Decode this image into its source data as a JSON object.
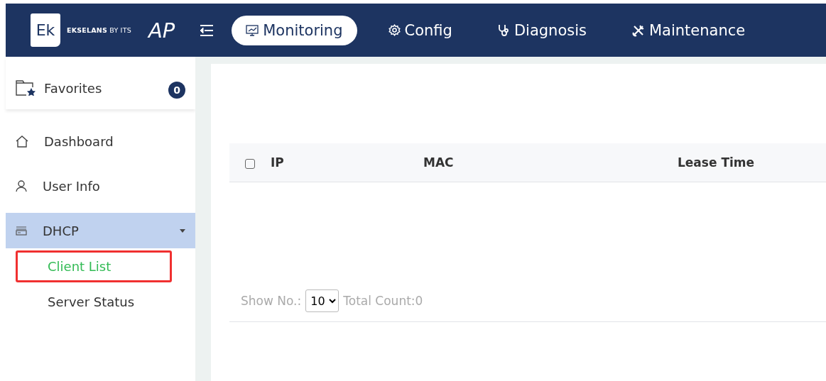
{
  "header": {
    "logo_mark": "Ek",
    "brand": "**EKSELANS** BY ITS",
    "product": "AP",
    "tabs": [
      {
        "label": "Monitoring",
        "selected": true
      },
      {
        "label": "Config",
        "selected": false
      },
      {
        "label": "Diagnosis",
        "selected": false
      },
      {
        "label": "Maintenance",
        "selected": false
      }
    ]
  },
  "sidebar": {
    "favorites": {
      "label": "Favorites",
      "count": "0"
    },
    "items": [
      {
        "label": "Dashboard",
        "selected": false
      },
      {
        "label": "User Info",
        "selected": false
      },
      {
        "label": "DHCP",
        "selected": true,
        "expanded": true,
        "children": [
          {
            "label": "Client List",
            "selected": true,
            "highlighted": true
          },
          {
            "label": "Server Status",
            "selected": false,
            "highlighted": false
          }
        ]
      }
    ]
  },
  "table": {
    "select_all_checked": false,
    "columns": [
      "IP",
      "MAC",
      "Lease Time"
    ],
    "footer": {
      "show_label": "Show No.:",
      "page_size": "10",
      "total": "Total Count:0"
    }
  }
}
